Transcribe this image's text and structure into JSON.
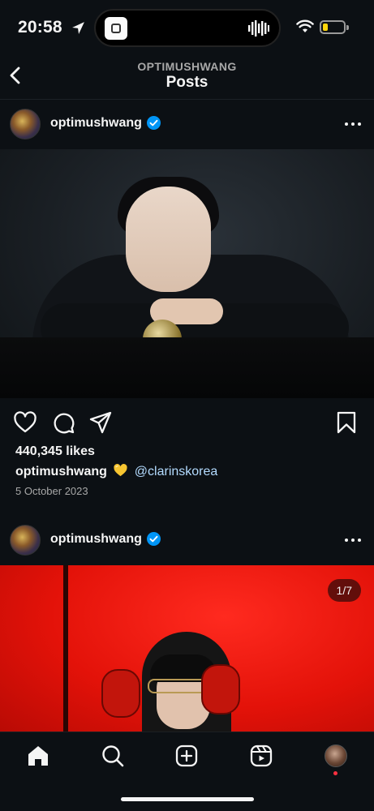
{
  "status_bar": {
    "time": "20:58",
    "battery_level": 0.25,
    "battery_color": "#ffd60a"
  },
  "header": {
    "subtitle": "OPTIMUSHWANG",
    "title": "Posts"
  },
  "posts": [
    {
      "username": "optimushwang",
      "verified": true,
      "likes": "440,345 likes",
      "caption_user": "optimushwang",
      "caption_emoji": "yellow-heart",
      "caption_mention": "@clarinskorea",
      "date": "5 October 2023"
    },
    {
      "username": "optimushwang",
      "verified": true,
      "carousel_counter": "1/7"
    }
  ],
  "tabbar": {
    "items": [
      "home-icon",
      "search-icon",
      "create-icon",
      "reels-icon",
      "profile-avatar"
    ],
    "active": "home-icon"
  },
  "colors": {
    "background": "#0c1014",
    "verified_blue": "#0095f6",
    "mention": "#b3dbff",
    "notification": "#ff3040"
  }
}
